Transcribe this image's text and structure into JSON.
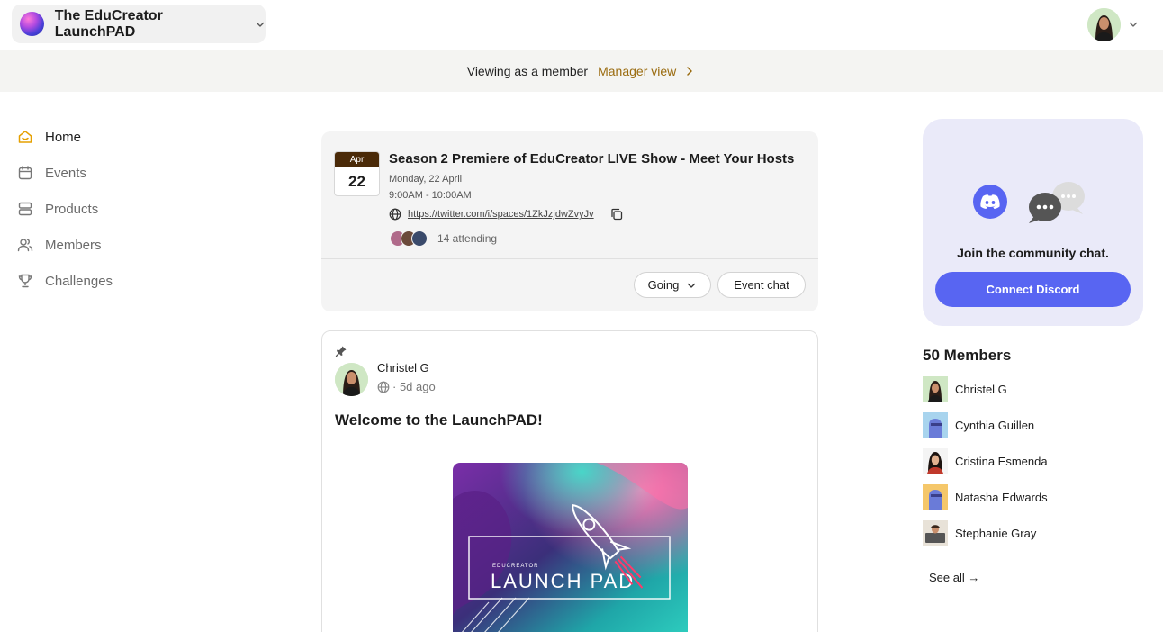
{
  "header": {
    "community_name": "The EduCreator LaunchPAD"
  },
  "member_bar": {
    "viewing_text": "Viewing as a member",
    "manager_link": "Manager view"
  },
  "sidebar": {
    "items": [
      {
        "label": "Home",
        "icon": "home-icon",
        "active": true
      },
      {
        "label": "Events",
        "icon": "calendar-icon",
        "active": false
      },
      {
        "label": "Products",
        "icon": "products-icon",
        "active": false
      },
      {
        "label": "Members",
        "icon": "members-icon",
        "active": false
      },
      {
        "label": "Challenges",
        "icon": "trophy-icon",
        "active": false
      }
    ]
  },
  "event": {
    "month": "Apr",
    "day": "22",
    "title": "Season 2 Premiere of EduCreator LIVE Show - Meet Your Hosts",
    "date": "Monday, 22 April",
    "time": "9:00AM - 10:00AM",
    "link": "https://twitter.com/i/spaces/1ZkJzjdwZvyJv",
    "attending": "14 attending",
    "going_label": "Going",
    "chat_label": "Event chat"
  },
  "post": {
    "author": "Christel G",
    "time": "· 5d ago",
    "title": "Welcome to the LaunchPAD!",
    "image_small_text": "EDUCREATOR",
    "image_big_text": "LAUNCH PAD"
  },
  "discord": {
    "join_text": "Join the community chat.",
    "connect_label": "Connect Discord"
  },
  "members": {
    "title": "50 Members",
    "list": [
      {
        "name": "Christel G"
      },
      {
        "name": "Cynthia Guillen"
      },
      {
        "name": "Cristina Esmenda"
      },
      {
        "name": "Natasha Edwards"
      },
      {
        "name": "Stephanie Gray"
      }
    ],
    "see_all": "See all →"
  },
  "colors": {
    "accent_brown": "#9a6b0f",
    "discord_blue": "#5865f2",
    "discord_card_bg": "#eaeaf9",
    "home_icon_orange": "#e5a000"
  }
}
